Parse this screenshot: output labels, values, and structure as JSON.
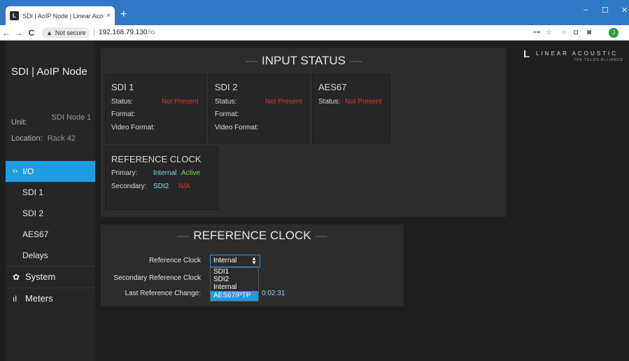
{
  "browser": {
    "tab_title": "SDI | AoIP Node | Linear Acoustic",
    "tab_favicon": "L",
    "tab_close": "×",
    "new_tab": "+",
    "win_min": "–",
    "win_max": "☐",
    "win_close": "✕",
    "back": "←",
    "forward": "→",
    "reload": "C",
    "security_label": "Not secure",
    "url_host": "192.168.79.130",
    "url_path": "/io",
    "profile_initial": "J"
  },
  "sidebar": {
    "node_title": "SDI | AoIP Node",
    "unit_label": "Unit:",
    "unit_value": "SDI Node 1",
    "location_label": "Location:",
    "location_value": "Rack 42",
    "io_label": "I/O",
    "io_icon": "‹›",
    "sub_items": [
      "SDI 1",
      "SDI 2",
      "AES67",
      "Delays"
    ],
    "system_label": "System",
    "meters_label": "Meters"
  },
  "logo": {
    "mark": "L",
    "word": "LINEAR ACOUSTIC",
    "sub": "THE TELOS ALLIANCE"
  },
  "input_status": {
    "title": "INPUT STATUS",
    "sdi1": {
      "title": "SDI 1",
      "status_label": "Status:",
      "status_value": "Not Present",
      "format_label": "Format:",
      "video_format_label": "Video Format:"
    },
    "sdi2": {
      "title": "SDI 2",
      "status_label": "Status:",
      "status_value": "Not Present",
      "format_label": "Format:",
      "video_format_label": "Video Format:"
    },
    "aes67": {
      "title": "AES67",
      "status_label": "Status:",
      "status_value": "Not Present"
    },
    "ref_clock": {
      "title": "REFERENCE CLOCK",
      "primary_label": "Primary:",
      "primary_source": "Internal",
      "primary_state": "Active",
      "secondary_label": "Secondary:",
      "secondary_source": "SDI2",
      "secondary_state": "N/A"
    }
  },
  "reference_clock": {
    "title": "REFERENCE CLOCK",
    "ref_label": "Reference Clock",
    "secondary_label": "Secondary Reference Clock",
    "last_change_label": "Last Reference Change:",
    "selected": "Internal",
    "options": [
      "SDI1",
      "SDI2",
      "Internal",
      "AES67/PTP"
    ],
    "highlighted_option": "AES67/PTP",
    "last_change_value": "0:02:31"
  },
  "colors": {
    "accent": "#1d9ce0",
    "error": "#e5322e",
    "active": "#7ed957",
    "info": "#8fd5f7"
  }
}
